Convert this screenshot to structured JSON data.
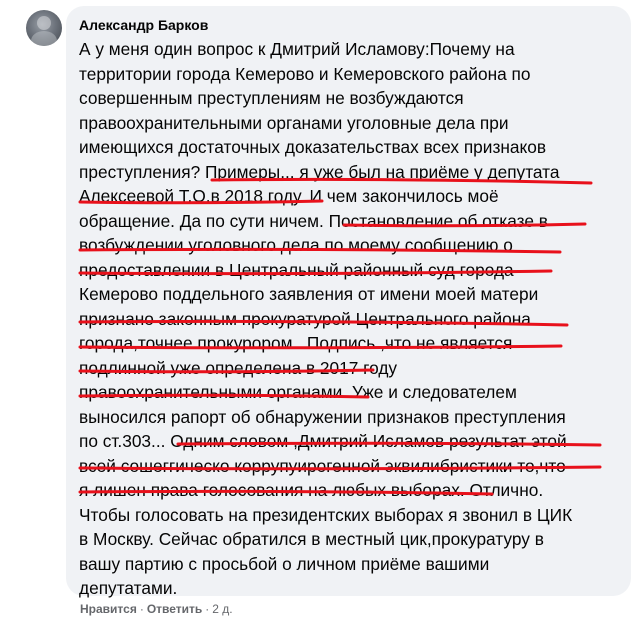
{
  "comment": {
    "author": "Александр Барков",
    "lines": [
      "А у меня один вопрос к Дмитрий Исламову:Почему на",
      "территории города Кемерово и Кемеровского района по",
      "совершенным преступлениям не возбуждаются",
      "правоохранительными органами уголовные дела при",
      "имеющихся достаточных доказательствах всех признаков",
      "преступления? Примеры... я уже был на приёме у депутата",
      "Алексеевой Т.О.в 2018 году. И чем закончилось моё",
      "обращение. Да по сути ничем. Постановление об отказе в",
      "возбуждении уголовного дела по моему сообщению о",
      "предоставлении в Центральный районный суд города",
      "Кемерово поддельного заявления от имени моей матери",
      "признано законным прокуратурой Центрального района",
      "города,точнее прокурором . Подпись ,что не является",
      "подлинной уже определена в 2017 году",
      "правоохранительными органами. Уже и следователем",
      "выносился рапорт об обнаружении признаков преступления",
      "по ст.303... Одним словом ,Дмитрий Исламов результат этой",
      "всей сошеггическо коррупуирогенной эквилибристики то,что",
      "я лишен права голосования на любых выборах. Отлично.",
      "Чтобы голосовать на президентских выборах я звонил в ЦИК",
      "в Москву. Сейчас обратился в местный цик,прокуратуру в",
      "вашу партию с просьбой о личном приёме вашими",
      "депутатами."
    ]
  },
  "actions": {
    "like": "Нравится",
    "separator": "·",
    "reply": "Ответить",
    "time": "2 д."
  },
  "colors": {
    "bubble": "#f0f2f5",
    "text": "#050505",
    "meta": "#65676b",
    "underline": "#e8111b"
  }
}
